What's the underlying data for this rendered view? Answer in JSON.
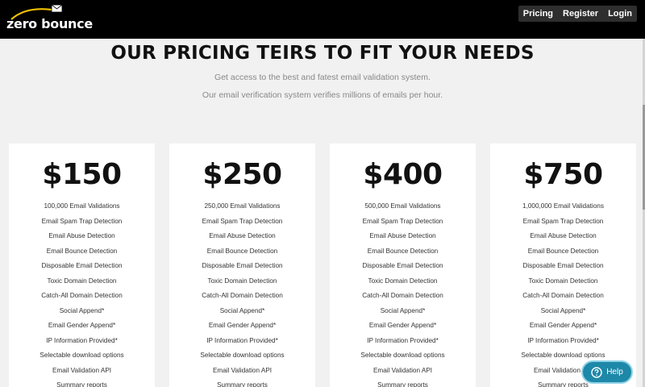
{
  "brand": {
    "name": "zero bounce",
    "logo_icon": "envelope-swoosh-icon"
  },
  "nav": {
    "items": [
      "Pricing",
      "Register",
      "Login"
    ]
  },
  "hero": {
    "title": "OUR PRICING TEIRS TO FIT YOUR NEEDS",
    "subtitle1": "Get access to the best and fatest email validation system.",
    "subtitle2": "Our email verification system verifies millions of emails per hour."
  },
  "plans": [
    {
      "price": "$150",
      "features": [
        "100,000 Email Validations",
        "Email Spam Trap Detection",
        "Email Abuse Detection",
        "Email Bounce Detection",
        "Disposable Email Detection",
        "Toxic Domain Detection",
        "Catch-All Domain Detection",
        "Social Append*",
        "Email Gender Append*",
        "IP Information Provided*",
        "Selectable download options",
        "Email Validation API",
        "Summary reports"
      ]
    },
    {
      "price": "$250",
      "features": [
        "250,000 Email Validations",
        "Email Spam Trap Detection",
        "Email Abuse Detection",
        "Email Bounce Detection",
        "Disposable Email Detection",
        "Toxic Domain Detection",
        "Catch-All Domain Detection",
        "Social Append*",
        "Email Gender Append*",
        "IP Information Provided*",
        "Selectable download options",
        "Email Validation API",
        "Summary reports"
      ]
    },
    {
      "price": "$400",
      "features": [
        "500,000 Email Validations",
        "Email Spam Trap Detection",
        "Email Abuse Detection",
        "Email Bounce Detection",
        "Disposable Email Detection",
        "Toxic Domain Detection",
        "Catch-All Domain Detection",
        "Social Append*",
        "Email Gender Append*",
        "IP Information Provided*",
        "Selectable download options",
        "Email Validation API",
        "Summary reports"
      ]
    },
    {
      "price": "$750",
      "features": [
        "1,000,000 Email Validations",
        "Email Spam Trap Detection",
        "Email Abuse Detection",
        "Email Bounce Detection",
        "Disposable Email Detection",
        "Toxic Domain Detection",
        "Catch-All Domain Detection",
        "Social Append*",
        "Email Gender Append*",
        "IP Information Provided*",
        "Selectable download options",
        "Email Validation API",
        "Summary reports"
      ]
    }
  ],
  "help": {
    "label": "Help",
    "icon": "question-circle-icon"
  },
  "colors": {
    "topbar": "#000000",
    "page_bg": "#f1f1f1",
    "card_bg": "#ffffff",
    "help_button": "#1e88a8",
    "logo_swoosh": "#f2c200"
  }
}
